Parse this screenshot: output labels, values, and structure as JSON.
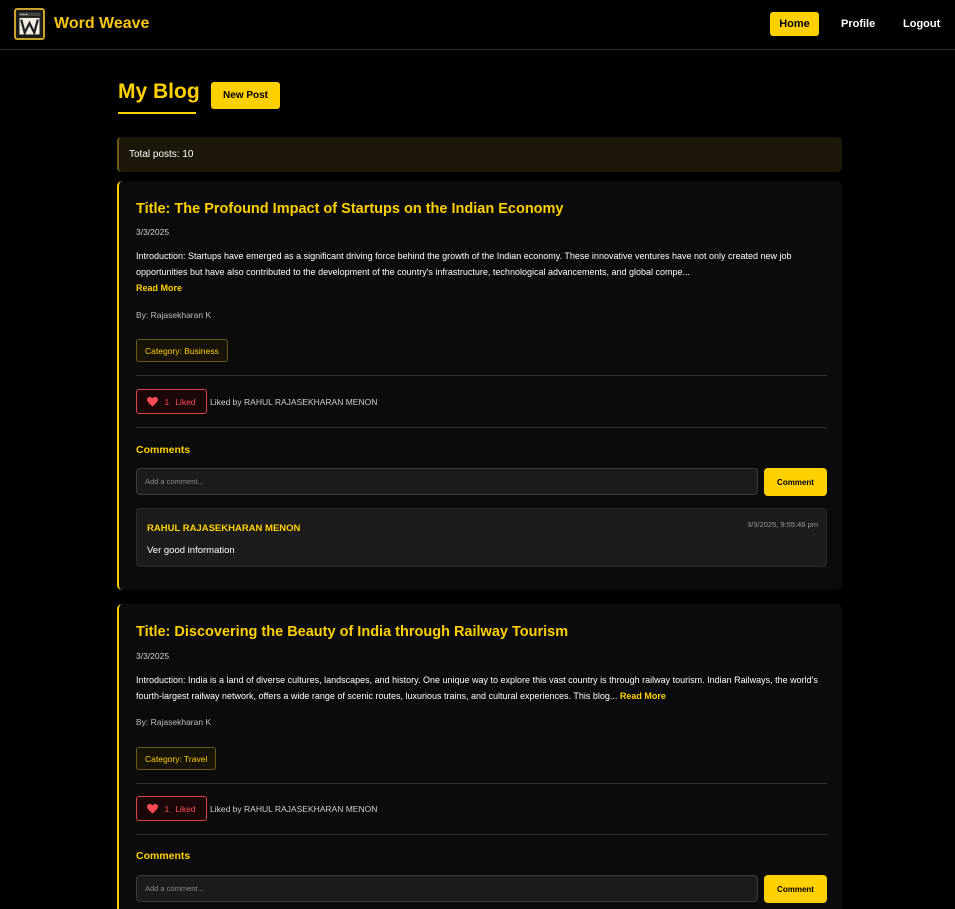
{
  "header": {
    "brand": "Word Weave",
    "nav": {
      "home": "Home",
      "profile": "Profile",
      "logout": "Logout"
    },
    "logo_icon": "ww-logo-icon"
  },
  "page": {
    "title": "My Blog",
    "new_post": "New Post",
    "total_posts": "Total posts: 10"
  },
  "posts": [
    {
      "title": "Title: The Profound Impact of Startups on the Indian Economy",
      "date": "3/3/2025",
      "intro": "Introduction: Startups have emerged as a significant driving force behind the growth of the Indian economy. These innovative ventures have not only created new job opportunities but have also contributed to the development of the country's infrastructure, technological advancements, and global compe...",
      "read_more": "Read More",
      "author": "By: Rajasekharan K",
      "category": "Category: Business",
      "likes": "1",
      "liked_label": "Liked",
      "liked_by": "Liked by RAHUL RAJASEKHARAN MENON",
      "comments_heading": "Comments",
      "comment_placeholder": "Add a comment...",
      "comment_button": "Comment",
      "comments": [
        {
          "author": "RAHUL RAJASEKHARAN MENON",
          "time": "3/3/2025, 9:55:46 pm",
          "text": "Ver good information"
        }
      ]
    },
    {
      "title": "Title: Discovering the Beauty of India through Railway Tourism",
      "date": "3/3/2025",
      "intro": "Introduction: India is a land of diverse cultures, landscapes, and history. One unique way to explore this vast country is through railway tourism. Indian Railways, the world's fourth-largest railway network, offers a wide range of scenic routes, luxurious trains, and cultural experiences. This blog...",
      "read_more": "Read More",
      "author": "By: Rajasekharan K",
      "category": "Category: Travel",
      "likes": "1",
      "liked_label": "Liked",
      "liked_by": "Liked by RAHUL RAJASEKHARAN MENON",
      "comments_heading": "Comments",
      "comment_placeholder": "Add a comment...",
      "comment_button": "Comment"
    }
  ],
  "colors": {
    "accent": "#ffd000",
    "background": "#000000",
    "card": "#0b0b0b",
    "like": "#ff4b55"
  }
}
